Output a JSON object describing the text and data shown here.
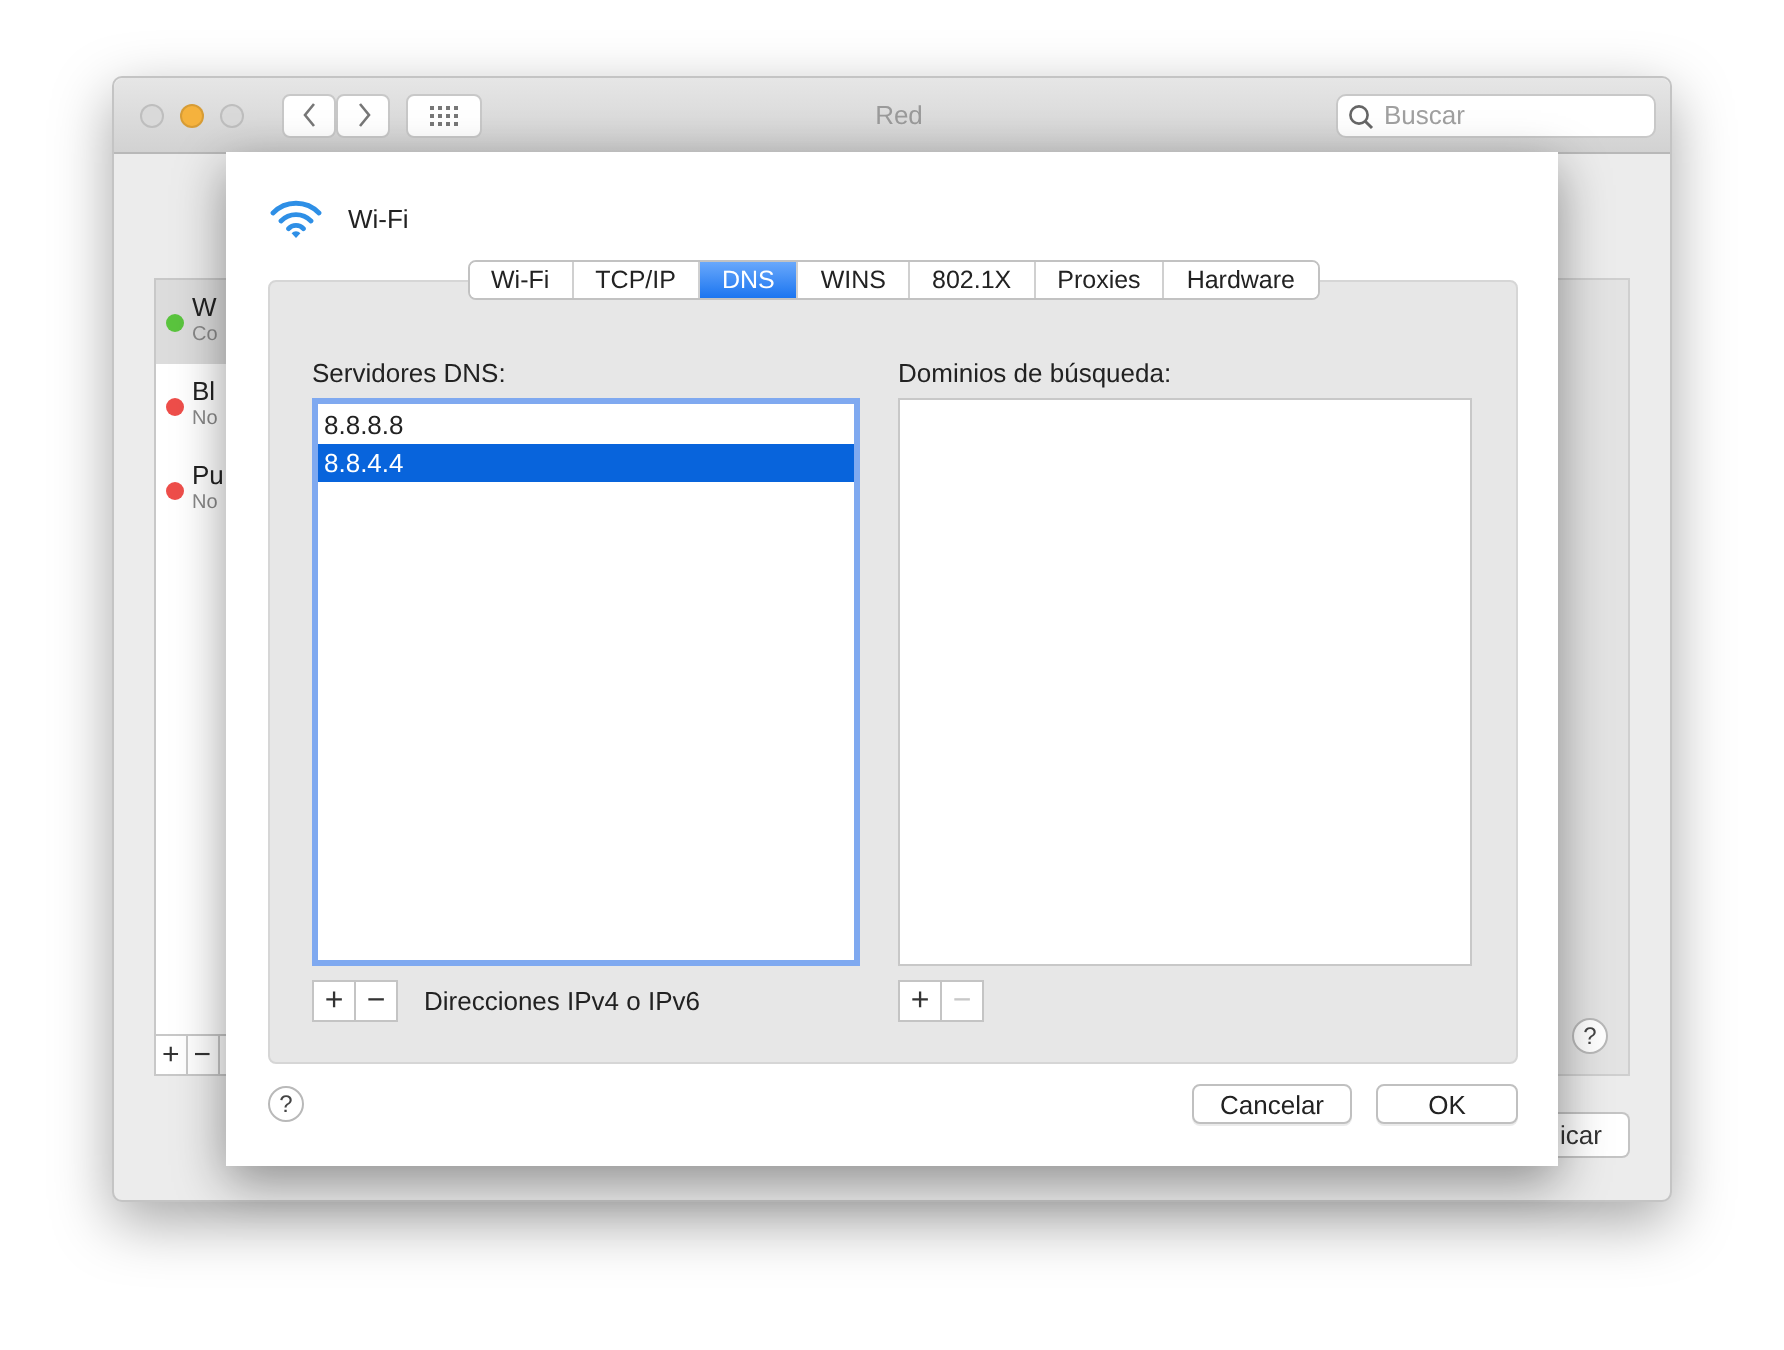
{
  "window": {
    "title": "Red",
    "search": {
      "placeholder": "Buscar"
    }
  },
  "sidebar": {
    "items": [
      {
        "name": "W",
        "status": "Co",
        "color": "#5ac43e",
        "selected": true
      },
      {
        "name": "Bl",
        "status": "No",
        "color": "#ee4e4a",
        "selected": false
      },
      {
        "name": "Pu",
        "status": "No",
        "color": "#ee4e4a",
        "selected": false
      }
    ],
    "buttons": [
      "+",
      "−"
    ]
  },
  "help": "?",
  "apply_button": "icar",
  "sheet": {
    "title": "Wi-Fi",
    "tabs": [
      {
        "label": "Wi-Fi",
        "selected": false
      },
      {
        "label": "TCP/IP",
        "selected": false
      },
      {
        "label": "DNS",
        "selected": true
      },
      {
        "label": "WINS",
        "selected": false
      },
      {
        "label": "802.1X",
        "selected": false
      },
      {
        "label": "Proxies",
        "selected": false
      },
      {
        "label": "Hardware",
        "selected": false
      }
    ],
    "dns_servers": {
      "label": "Servidores DNS:",
      "focused": true,
      "rows": [
        {
          "text": "8.8.8.8",
          "selected": false
        },
        {
          "text": "8.8.4.4",
          "selected": true
        }
      ],
      "buttons": [
        {
          "label": "+",
          "disabled": false
        },
        {
          "label": "−",
          "disabled": false
        }
      ],
      "hint": "Direcciones IPv4 o IPv6"
    },
    "search_domains": {
      "label": "Dominios de búsqueda:",
      "focused": false,
      "buttons": [
        {
          "label": "+",
          "disabled": false
        },
        {
          "label": "−",
          "disabled": true
        }
      ]
    },
    "help": "?",
    "buttons": [
      "Cancelar",
      "OK"
    ]
  }
}
